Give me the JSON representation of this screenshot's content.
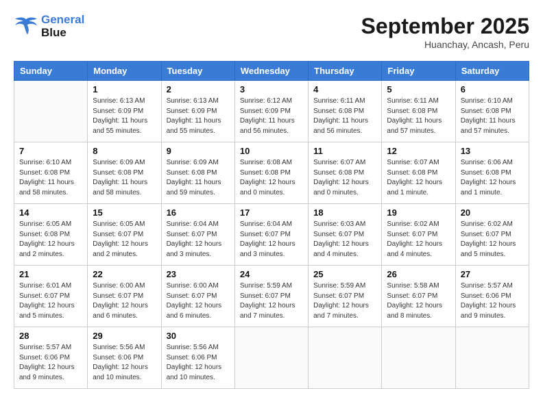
{
  "header": {
    "logo_line1": "General",
    "logo_line2": "Blue",
    "month_title": "September 2025",
    "location": "Huanchay, Ancash, Peru"
  },
  "days_of_week": [
    "Sunday",
    "Monday",
    "Tuesday",
    "Wednesday",
    "Thursday",
    "Friday",
    "Saturday"
  ],
  "weeks": [
    [
      {
        "day": "",
        "info": ""
      },
      {
        "day": "1",
        "info": "Sunrise: 6:13 AM\nSunset: 6:09 PM\nDaylight: 11 hours\nand 55 minutes."
      },
      {
        "day": "2",
        "info": "Sunrise: 6:13 AM\nSunset: 6:09 PM\nDaylight: 11 hours\nand 55 minutes."
      },
      {
        "day": "3",
        "info": "Sunrise: 6:12 AM\nSunset: 6:09 PM\nDaylight: 11 hours\nand 56 minutes."
      },
      {
        "day": "4",
        "info": "Sunrise: 6:11 AM\nSunset: 6:08 PM\nDaylight: 11 hours\nand 56 minutes."
      },
      {
        "day": "5",
        "info": "Sunrise: 6:11 AM\nSunset: 6:08 PM\nDaylight: 11 hours\nand 57 minutes."
      },
      {
        "day": "6",
        "info": "Sunrise: 6:10 AM\nSunset: 6:08 PM\nDaylight: 11 hours\nand 57 minutes."
      }
    ],
    [
      {
        "day": "7",
        "info": "Sunrise: 6:10 AM\nSunset: 6:08 PM\nDaylight: 11 hours\nand 58 minutes."
      },
      {
        "day": "8",
        "info": "Sunrise: 6:09 AM\nSunset: 6:08 PM\nDaylight: 11 hours\nand 58 minutes."
      },
      {
        "day": "9",
        "info": "Sunrise: 6:09 AM\nSunset: 6:08 PM\nDaylight: 11 hours\nand 59 minutes."
      },
      {
        "day": "10",
        "info": "Sunrise: 6:08 AM\nSunset: 6:08 PM\nDaylight: 12 hours\nand 0 minutes."
      },
      {
        "day": "11",
        "info": "Sunrise: 6:07 AM\nSunset: 6:08 PM\nDaylight: 12 hours\nand 0 minutes."
      },
      {
        "day": "12",
        "info": "Sunrise: 6:07 AM\nSunset: 6:08 PM\nDaylight: 12 hours\nand 1 minute."
      },
      {
        "day": "13",
        "info": "Sunrise: 6:06 AM\nSunset: 6:08 PM\nDaylight: 12 hours\nand 1 minute."
      }
    ],
    [
      {
        "day": "14",
        "info": "Sunrise: 6:05 AM\nSunset: 6:08 PM\nDaylight: 12 hours\nand 2 minutes."
      },
      {
        "day": "15",
        "info": "Sunrise: 6:05 AM\nSunset: 6:07 PM\nDaylight: 12 hours\nand 2 minutes."
      },
      {
        "day": "16",
        "info": "Sunrise: 6:04 AM\nSunset: 6:07 PM\nDaylight: 12 hours\nand 3 minutes."
      },
      {
        "day": "17",
        "info": "Sunrise: 6:04 AM\nSunset: 6:07 PM\nDaylight: 12 hours\nand 3 minutes."
      },
      {
        "day": "18",
        "info": "Sunrise: 6:03 AM\nSunset: 6:07 PM\nDaylight: 12 hours\nand 4 minutes."
      },
      {
        "day": "19",
        "info": "Sunrise: 6:02 AM\nSunset: 6:07 PM\nDaylight: 12 hours\nand 4 minutes."
      },
      {
        "day": "20",
        "info": "Sunrise: 6:02 AM\nSunset: 6:07 PM\nDaylight: 12 hours\nand 5 minutes."
      }
    ],
    [
      {
        "day": "21",
        "info": "Sunrise: 6:01 AM\nSunset: 6:07 PM\nDaylight: 12 hours\nand 5 minutes."
      },
      {
        "day": "22",
        "info": "Sunrise: 6:00 AM\nSunset: 6:07 PM\nDaylight: 12 hours\nand 6 minutes."
      },
      {
        "day": "23",
        "info": "Sunrise: 6:00 AM\nSunset: 6:07 PM\nDaylight: 12 hours\nand 6 minutes."
      },
      {
        "day": "24",
        "info": "Sunrise: 5:59 AM\nSunset: 6:07 PM\nDaylight: 12 hours\nand 7 minutes."
      },
      {
        "day": "25",
        "info": "Sunrise: 5:59 AM\nSunset: 6:07 PM\nDaylight: 12 hours\nand 7 minutes."
      },
      {
        "day": "26",
        "info": "Sunrise: 5:58 AM\nSunset: 6:07 PM\nDaylight: 12 hours\nand 8 minutes."
      },
      {
        "day": "27",
        "info": "Sunrise: 5:57 AM\nSunset: 6:06 PM\nDaylight: 12 hours\nand 9 minutes."
      }
    ],
    [
      {
        "day": "28",
        "info": "Sunrise: 5:57 AM\nSunset: 6:06 PM\nDaylight: 12 hours\nand 9 minutes."
      },
      {
        "day": "29",
        "info": "Sunrise: 5:56 AM\nSunset: 6:06 PM\nDaylight: 12 hours\nand 10 minutes."
      },
      {
        "day": "30",
        "info": "Sunrise: 5:56 AM\nSunset: 6:06 PM\nDaylight: 12 hours\nand 10 minutes."
      },
      {
        "day": "",
        "info": ""
      },
      {
        "day": "",
        "info": ""
      },
      {
        "day": "",
        "info": ""
      },
      {
        "day": "",
        "info": ""
      }
    ]
  ]
}
